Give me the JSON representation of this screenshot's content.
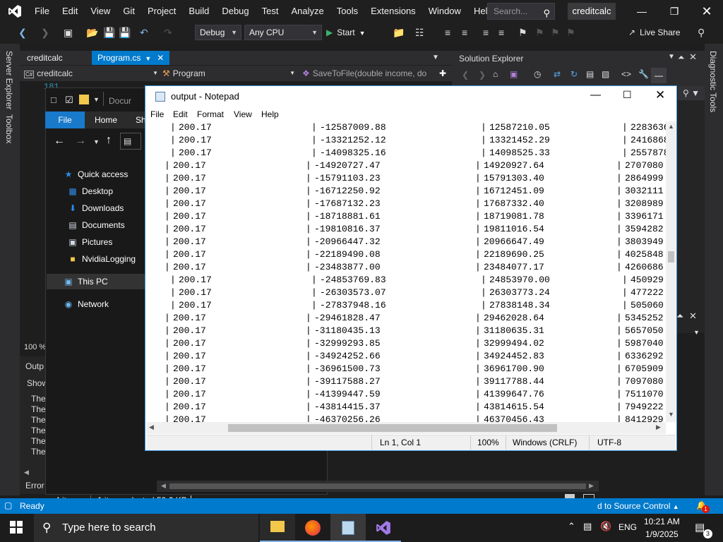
{
  "vs": {
    "menu": [
      "File",
      "Edit",
      "View",
      "Git",
      "Project",
      "Build",
      "Debug",
      "Test",
      "Analyze",
      "Tools",
      "Extensions",
      "Window",
      "Help"
    ],
    "search_placeholder": "Search...",
    "solution_name": "creditcalc",
    "config": "Debug",
    "platform": "Any CPU",
    "start_label": "Start",
    "live_share": "Live Share",
    "left_strip": [
      "Server Explorer",
      "Toolbox"
    ],
    "right_strip": "Diagnostic Tools",
    "tabs": [
      {
        "label": "creditcalc",
        "active": false
      },
      {
        "label": "Program.cs",
        "active": true
      }
    ],
    "nav": {
      "project": "creditcalc",
      "class": "Program",
      "member": "SaveToFile(double income, do"
    },
    "line_number": "181",
    "solution_explorer_title": "Solution Explorer",
    "zoom_label": "100 %",
    "output_title": "Outp",
    "output_show": "Show",
    "output_lines": [
      "The",
      "The",
      "The",
      "The",
      "The",
      "The"
    ],
    "error_tab": "Error",
    "status": {
      "ready": "Ready",
      "source_control": "d to Source Control",
      "notif_count": "1"
    },
    "accent": "#007acc"
  },
  "explorer": {
    "path_partial": "Docur",
    "ribbon_tabs": [
      "File",
      "Home",
      "Sh"
    ],
    "nav_items": [
      {
        "label": "Quick access",
        "icon": "star-icon",
        "color": "#2f8be6",
        "indent": 0
      },
      {
        "label": "Desktop",
        "icon": "desktop-icon",
        "color": "#2f8be6",
        "indent": 1
      },
      {
        "label": "Downloads",
        "icon": "download-icon",
        "color": "#2f8be6",
        "indent": 1
      },
      {
        "label": "Documents",
        "icon": "document-icon",
        "color": "#cfd8e3",
        "indent": 1
      },
      {
        "label": "Pictures",
        "icon": "picture-icon",
        "color": "#cfd8e3",
        "indent": 1
      },
      {
        "label": "NvidiaLogging",
        "icon": "folder-icon",
        "color": "#f2c84b",
        "indent": 1
      },
      {
        "label": "This PC",
        "icon": "pc-icon",
        "color": "#6fb8f0",
        "indent": 0,
        "selected": true
      },
      {
        "label": "Network",
        "icon": "network-icon",
        "color": "#6fb8f0",
        "indent": 0
      }
    ],
    "status": {
      "items": "4 items",
      "selected": "1 item selected",
      "size": "59.6 KB"
    }
  },
  "notepad": {
    "title": "output - Notepad",
    "menu": [
      "File",
      "Edit",
      "Format",
      "View",
      "Help"
    ],
    "rows": [
      {
        "c1": "200.17",
        "c2": "-12587009.88",
        "c3": "12587210.05",
        "c4": "2283636",
        "shift": true
      },
      {
        "c1": "200.17",
        "c2": "-13321252.12",
        "c3": "13321452.29",
        "c4": "2416868",
        "shift": true
      },
      {
        "c1": "200.17",
        "c2": "-14098325.16",
        "c3": "14098525.33",
        "c4": "2557878",
        "shift": true
      },
      {
        "c1": "200.17",
        "c2": "-14920727.47",
        "c3": "14920927.64",
        "c4": "2707080",
        "shift": false
      },
      {
        "c1": "200.17",
        "c2": "-15791103.23",
        "c3": "15791303.40",
        "c4": "2864999",
        "shift": false
      },
      {
        "c1": "200.17",
        "c2": "-16712250.92",
        "c3": "16712451.09",
        "c4": "3032111",
        "shift": false
      },
      {
        "c1": "200.17",
        "c2": "-17687132.23",
        "c3": "17687332.40",
        "c4": "3208989",
        "shift": false
      },
      {
        "c1": "200.17",
        "c2": "-18718881.61",
        "c3": "18719081.78",
        "c4": "3396171",
        "shift": false
      },
      {
        "c1": "200.17",
        "c2": "-19810816.37",
        "c3": "19811016.54",
        "c4": "3594282",
        "shift": false
      },
      {
        "c1": "200.17",
        "c2": "-20966447.32",
        "c3": "20966647.49",
        "c4": "3803949",
        "shift": false
      },
      {
        "c1": "200.17",
        "c2": "-22189490.08",
        "c3": "22189690.25",
        "c4": "4025848",
        "shift": false
      },
      {
        "c1": "200.17",
        "c2": "-23483877.00",
        "c3": "23484077.17",
        "c4": "4260686",
        "shift": false
      },
      {
        "c1": "200.17",
        "c2": "-24853769.83",
        "c3": "24853970.00",
        "c4": "450929",
        "shift": true
      },
      {
        "c1": "200.17",
        "c2": "-26303573.07",
        "c3": "26303773.24",
        "c4": "477222",
        "shift": true
      },
      {
        "c1": "200.17",
        "c2": "-27837948.16",
        "c3": "27838148.34",
        "c4": "505060",
        "shift": true
      },
      {
        "c1": "200.17",
        "c2": "-29461828.47",
        "c3": "29462028.64",
        "c4": "5345252",
        "shift": false
      },
      {
        "c1": "200.17",
        "c2": "-31180435.13",
        "c3": "31180635.31",
        "c4": "5657050",
        "shift": false
      },
      {
        "c1": "200.17",
        "c2": "-32999293.85",
        "c3": "32999494.02",
        "c4": "5987040",
        "shift": false
      },
      {
        "c1": "200.17",
        "c2": "-34924252.66",
        "c3": "34924452.83",
        "c4": "6336292",
        "shift": false
      },
      {
        "c1": "200.17",
        "c2": "-36961500.73",
        "c3": "36961700.90",
        "c4": "6705909",
        "shift": false
      },
      {
        "c1": "200.17",
        "c2": "-39117588.27",
        "c3": "39117788.44",
        "c4": "7097080",
        "shift": false
      },
      {
        "c1": "200.17",
        "c2": "-41399447.59",
        "c3": "41399647.76",
        "c4": "7511070",
        "shift": false
      },
      {
        "c1": "200.17",
        "c2": "-43814415.37",
        "c3": "43814615.54",
        "c4": "7949222",
        "shift": false
      },
      {
        "c1": "200.17",
        "c2": "-46370256.26",
        "c3": "46370456.43",
        "c4": "8412929",
        "shift": false
      }
    ],
    "status": {
      "position": "Ln 1, Col 1",
      "zoom": "100%",
      "line_ending": "Windows (CRLF)",
      "encoding": "UTF-8"
    }
  },
  "taskbar": {
    "search_placeholder": "Type here to search",
    "language": "ENG",
    "time": "10:21 AM",
    "date": "1/9/2025",
    "notif_count": "3"
  }
}
